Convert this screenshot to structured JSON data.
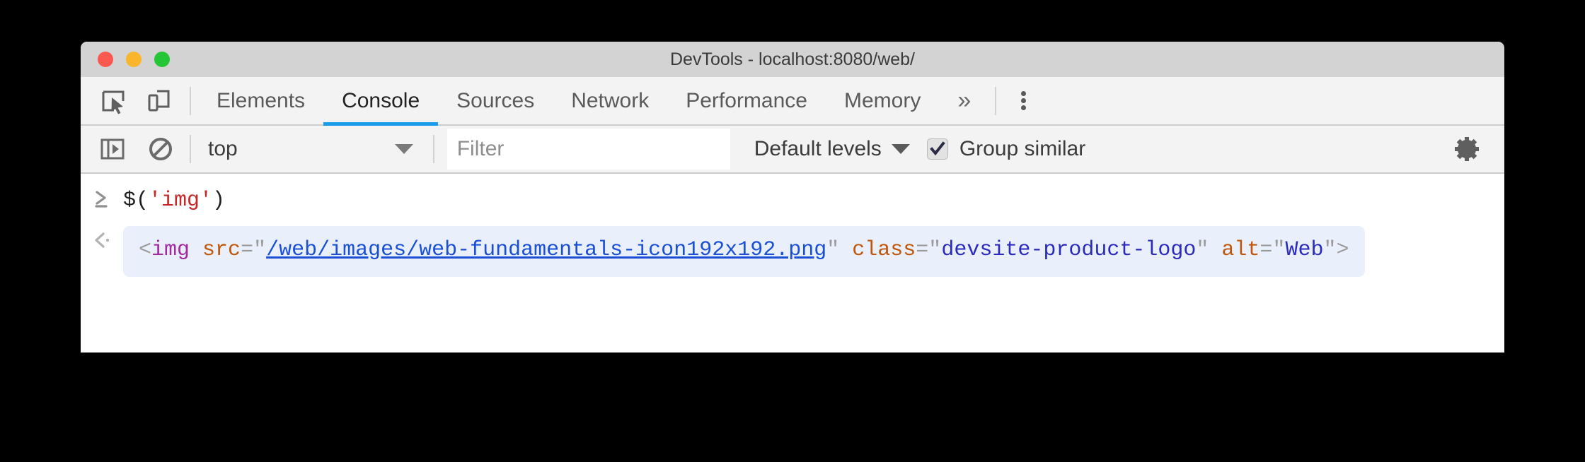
{
  "window": {
    "title": "DevTools - localhost:8080/web/",
    "traffic_lights": [
      {
        "name": "close",
        "color": "#f9594f"
      },
      {
        "name": "minimize",
        "color": "#f9b52c"
      },
      {
        "name": "maximize",
        "color": "#25c636"
      }
    ]
  },
  "tab_bar": {
    "inspect_icon": "inspect-element-icon",
    "device_icon": "device-toolbar-icon",
    "tabs": [
      {
        "label": "Elements",
        "active": false
      },
      {
        "label": "Console",
        "active": true
      },
      {
        "label": "Sources",
        "active": false
      },
      {
        "label": "Network",
        "active": false
      },
      {
        "label": "Performance",
        "active": false
      },
      {
        "label": "Memory",
        "active": false
      }
    ],
    "more_tabs_label": "»",
    "menu_icon": "kebab-menu-icon",
    "active_tab_accent": "#1a9ceb"
  },
  "console_toolbar": {
    "sidebar_toggle_icon": "console-sidebar-toggle-icon",
    "clear_icon": "clear-console-icon",
    "context": {
      "value": "top",
      "caret": "▼"
    },
    "filter": {
      "value": "",
      "placeholder": "Filter"
    },
    "levels": {
      "value": "Default levels",
      "caret": "▼"
    },
    "group_similar": {
      "label": "Group similar",
      "checked": true
    },
    "settings_icon": "gear-icon"
  },
  "console": {
    "prompt": {
      "marker": "prompt-chevron-icon",
      "expression": "$('img')",
      "tokens": [
        {
          "text": "$(",
          "type": "plain"
        },
        {
          "text": "'img'",
          "type": "string"
        },
        {
          "text": ")",
          "type": "plain"
        }
      ]
    },
    "result": {
      "marker": "result-chevron-icon",
      "text": "<img src=\"/web/images/web-fundamentals-icon192x192.png\" class=\"devsite-product-logo\" alt=\"Web\">",
      "tag": "img",
      "attributes": [
        {
          "name": "src",
          "value": "/web/images/web-fundamentals-icon192x192.png",
          "is_link": true
        },
        {
          "name": "class",
          "value": "devsite-product-logo",
          "is_link": false
        },
        {
          "name": "alt",
          "value": "Web",
          "is_link": false
        }
      ],
      "background": "#e9f0fb"
    }
  },
  "colors": {
    "string_literal": "#c62828",
    "tag_name": "#a32aa3",
    "attr_name": "#c0570d",
    "attr_value": "#2b2bbd",
    "link": "#1a4fd6",
    "punctuation": "#9b9b9b"
  }
}
